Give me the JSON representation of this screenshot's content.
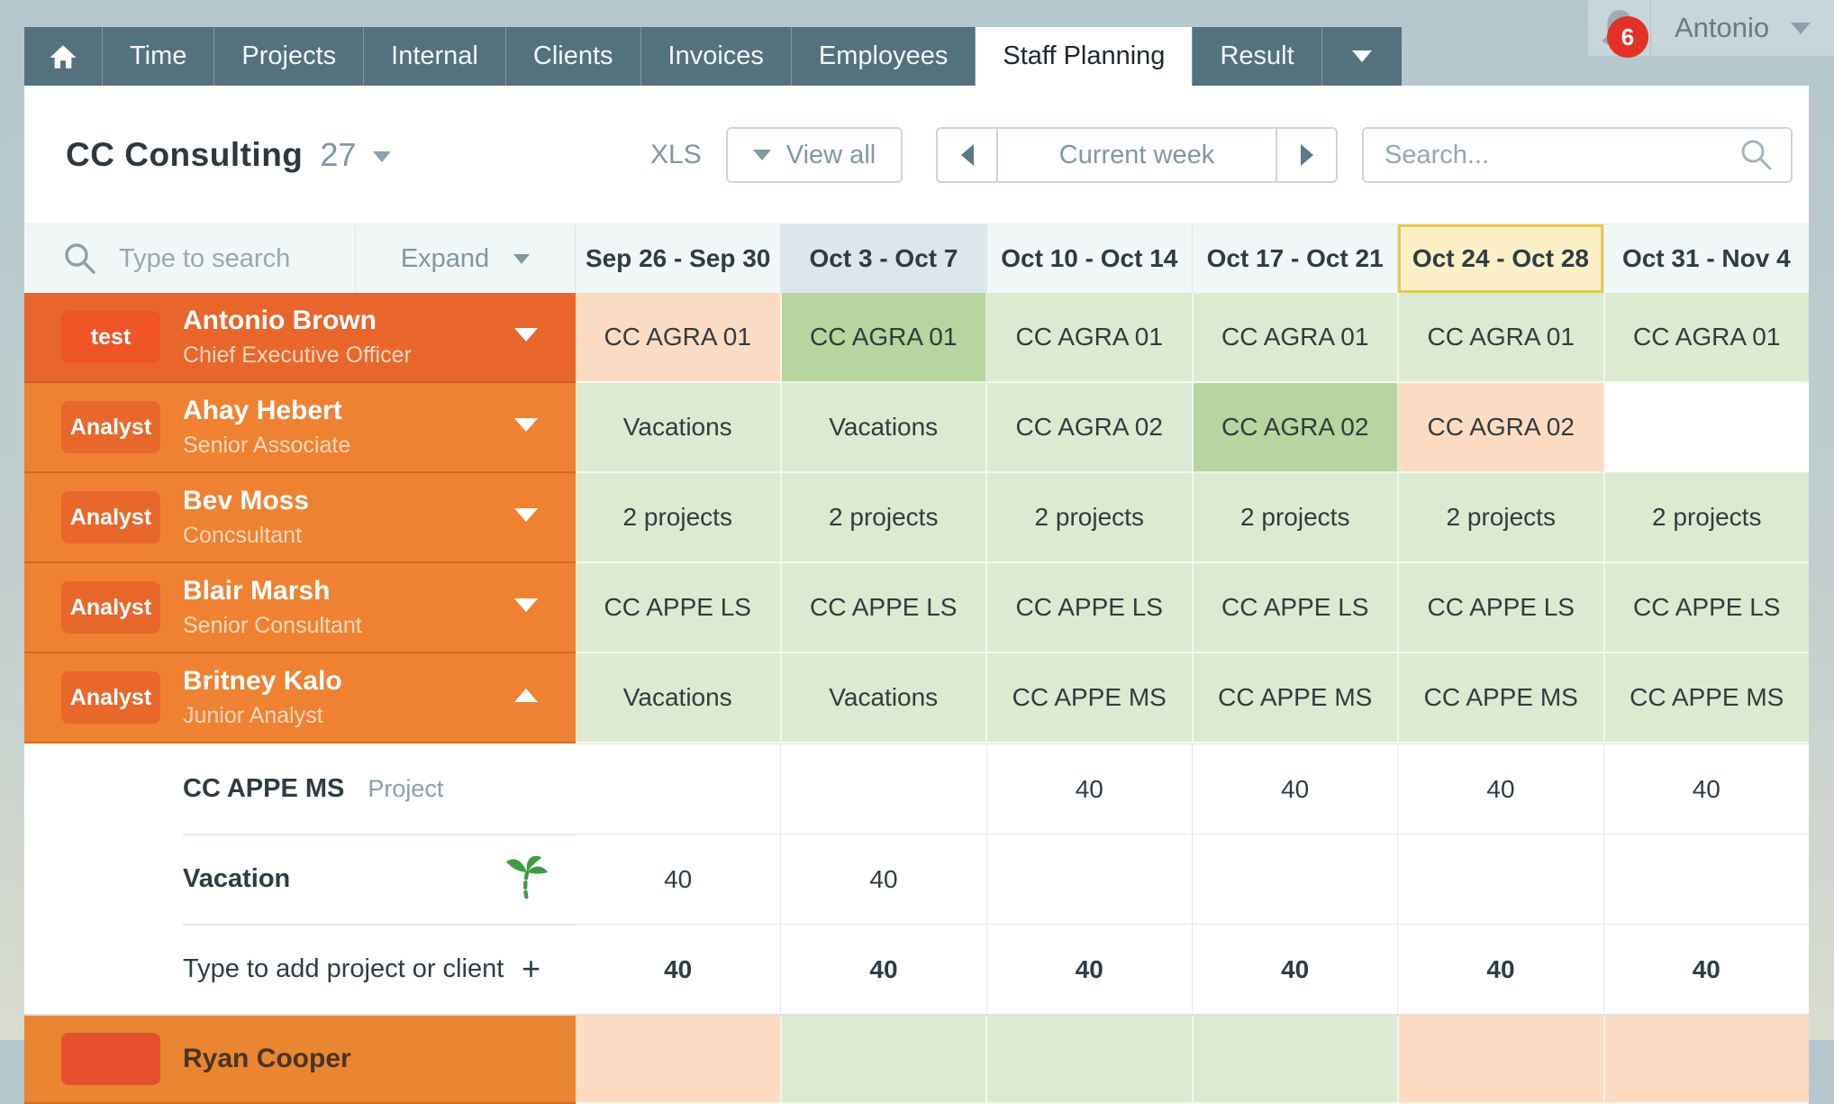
{
  "nav": {
    "tabs": [
      "Time",
      "Projects",
      "Internal",
      "Clients",
      "Invoices",
      "Employees",
      "Staff Planning",
      "Result"
    ],
    "active_tab": "Staff Planning",
    "notification_count": "6",
    "user_name": "Antonio"
  },
  "header": {
    "title": "CC Consulting",
    "count": "27",
    "xls_label": "XLS",
    "view_all_label": "View all",
    "week_label": "Current week",
    "search_placeholder": "Search..."
  },
  "table": {
    "search_placeholder": "Type to search",
    "expand_label": "Expand",
    "columns": [
      {
        "label": "Sep 26 - Sep 30",
        "state": "normal"
      },
      {
        "label": "Oct 3 - Oct 7",
        "state": "current"
      },
      {
        "label": "Oct 10 - Oct 14",
        "state": "normal"
      },
      {
        "label": "Oct 17 - Oct 21",
        "state": "normal"
      },
      {
        "label": "Oct 24 - Oct 28",
        "state": "selected"
      },
      {
        "label": "Oct 31 - Nov 4",
        "state": "normal"
      }
    ],
    "rows": [
      {
        "badge": "test",
        "name": "Antonio Brown",
        "role": "Chief Executive Officer",
        "variant": "primary",
        "caret": "down",
        "cells": [
          {
            "text": "CC AGRA 01",
            "color": "peach"
          },
          {
            "text": "CC AGRA 01",
            "color": "dark_green"
          },
          {
            "text": "CC AGRA 01",
            "color": "green"
          },
          {
            "text": "CC AGRA 01",
            "color": "green"
          },
          {
            "text": "CC AGRA 01",
            "color": "green"
          },
          {
            "text": "CC AGRA 01",
            "color": "green"
          }
        ]
      },
      {
        "badge": "Analyst",
        "name": "Ahay Hebert",
        "role": "Senior Associate",
        "variant": "secondary",
        "caret": "down",
        "cells": [
          {
            "text": "Vacations",
            "color": "green"
          },
          {
            "text": "Vacations",
            "color": "green"
          },
          {
            "text": "CC AGRA 02",
            "color": "green"
          },
          {
            "text": "CC AGRA 02",
            "color": "dark_green"
          },
          {
            "text": "CC AGRA 02",
            "color": "peach"
          },
          {
            "text": "",
            "color": "white"
          }
        ]
      },
      {
        "badge": "Analyst",
        "name": "Bev Moss",
        "role": "Concsultant",
        "variant": "secondary",
        "caret": "down",
        "cells": [
          {
            "text": "2 projects",
            "color": "green"
          },
          {
            "text": "2 projects",
            "color": "green"
          },
          {
            "text": "2 projects",
            "color": "green"
          },
          {
            "text": "2 projects",
            "color": "green"
          },
          {
            "text": "2 projects",
            "color": "green"
          },
          {
            "text": "2 projects",
            "color": "green"
          }
        ]
      },
      {
        "badge": "Analyst",
        "name": "Blair Marsh",
        "role": "Senior Consultant",
        "variant": "secondary",
        "caret": "down",
        "cells": [
          {
            "text": "CC APPE LS",
            "color": "green"
          },
          {
            "text": "CC APPE LS",
            "color": "green"
          },
          {
            "text": "CC APPE LS",
            "color": "green"
          },
          {
            "text": "CC APPE LS",
            "color": "green"
          },
          {
            "text": "CC APPE LS",
            "color": "green"
          },
          {
            "text": "CC APPE LS",
            "color": "green"
          }
        ]
      },
      {
        "badge": "Analyst",
        "name": "Britney Kalo",
        "role": "Junior Analyst",
        "variant": "secondary",
        "caret": "up",
        "cells": [
          {
            "text": "Vacations",
            "color": "green"
          },
          {
            "text": "Vacations",
            "color": "green"
          },
          {
            "text": "CC APPE MS",
            "color": "green"
          },
          {
            "text": "CC APPE MS",
            "color": "green"
          },
          {
            "text": "CC APPE MS",
            "color": "green"
          },
          {
            "text": "CC APPE MS",
            "color": "green"
          }
        ]
      }
    ],
    "subrows": [
      {
        "title": "CC APPE MS",
        "tag": "Project",
        "icon": "none",
        "bold": false,
        "values": [
          "",
          "",
          "40",
          "40",
          "40",
          "40"
        ]
      },
      {
        "title": "Vacation",
        "tag": "",
        "icon": "palm-tree",
        "bold": false,
        "values": [
          "40",
          "40",
          "",
          "",
          "",
          ""
        ]
      },
      {
        "title": "Type to add project or client",
        "tag": "",
        "icon": "plus",
        "bold": true,
        "values": [
          "40",
          "40",
          "40",
          "40",
          "40",
          "40"
        ]
      }
    ],
    "partial_row": {
      "name": "Ryan Cooper",
      "badge": "",
      "variant": "secondary",
      "cells": [
        {
          "text": "",
          "color": "peach"
        },
        {
          "text": "",
          "color": "green"
        },
        {
          "text": "",
          "color": "green"
        },
        {
          "text": "",
          "color": "green"
        },
        {
          "text": "",
          "color": "peach"
        },
        {
          "text": "",
          "color": "peach"
        }
      ]
    }
  },
  "colors": {
    "nav_teal": "#54727e",
    "notification_red": "#e23227",
    "deep_orange_row": "#e8662c",
    "orange_row": "#ef8232",
    "badge_red_orange": "#ee5426",
    "badge_orange": "#e8672b",
    "cell_green": "#dcead1",
    "cell_dark_green": "#b7d59e",
    "cell_peach": "#fbdcc3",
    "selected_yellow": "#fbf0c5",
    "yellow_border": "#e7c94a"
  }
}
